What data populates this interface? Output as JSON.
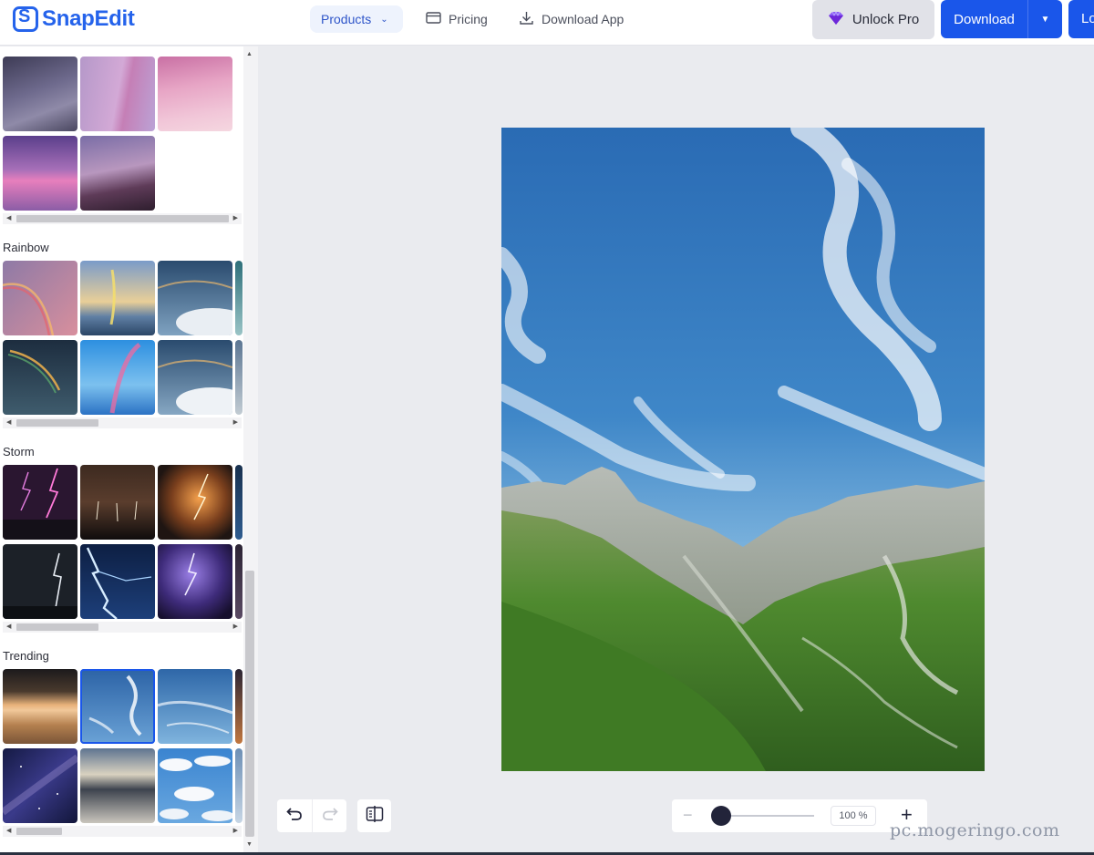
{
  "header": {
    "brand": "SnapEdit",
    "nav": {
      "products": "Products",
      "pricing": "Pricing",
      "download_app": "Download App"
    },
    "unlock_pro": "Unlock Pro",
    "download": "Download",
    "login_partial": "Lo"
  },
  "sidebar": {
    "sections": [
      {
        "title": "Rainbow"
      },
      {
        "title": "Storm"
      },
      {
        "title": "Trending"
      }
    ]
  },
  "canvas": {
    "zoom": {
      "value": "100 %",
      "minus": "−",
      "plus": "+"
    }
  },
  "watermark": "pc.mogeringo.com",
  "icons": {
    "products_chevron": "chevron-down-icon",
    "pricing": "pricing-card-icon",
    "download_app": "download-icon",
    "unlock_pro": "gem-icon",
    "download_caret": "caret-down-icon",
    "undo": "undo-icon",
    "redo": "redo-icon",
    "compare": "compare-icon"
  },
  "colors": {
    "brand": "#2563eb",
    "primary_button": "#1a56ea",
    "selected_thumbnail": "#1a56ea",
    "canvas_background": "#eaebef"
  }
}
